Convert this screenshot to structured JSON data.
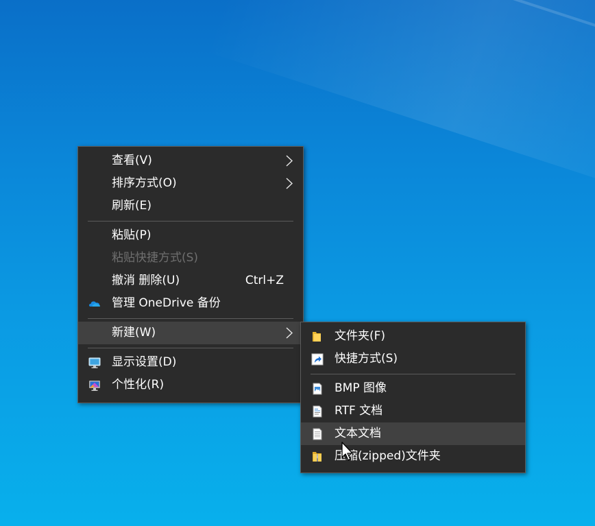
{
  "context_menu": {
    "items": [
      {
        "label": "查看(V)",
        "has_submenu": true
      },
      {
        "label": "排序方式(O)",
        "has_submenu": true
      },
      {
        "label": "刷新(E)"
      },
      {
        "label": "粘贴(P)"
      },
      {
        "label": "粘贴快捷方式(S)",
        "disabled": true
      },
      {
        "label": "撤消 删除(U)",
        "shortcut": "Ctrl+Z"
      },
      {
        "label": "管理 OneDrive 备份",
        "icon": "onedrive-icon"
      },
      {
        "label": "新建(W)",
        "has_submenu": true,
        "highlighted": true
      },
      {
        "label": "显示设置(D)",
        "icon": "display-settings-icon"
      },
      {
        "label": "个性化(R)",
        "icon": "personalize-icon"
      }
    ]
  },
  "new_submenu": {
    "items": [
      {
        "label": "文件夹(F)",
        "icon": "folder-icon"
      },
      {
        "label": "快捷方式(S)",
        "icon": "shortcut-icon"
      },
      {
        "label": "BMP 图像",
        "icon": "bitmap-icon"
      },
      {
        "label": "RTF 文档",
        "icon": "rtf-document-icon"
      },
      {
        "label": "文本文档",
        "icon": "text-document-icon",
        "highlighted": true
      },
      {
        "label": "压缩(zipped)文件夹",
        "icon": "zip-folder-icon"
      }
    ]
  },
  "colors": {
    "menu_background": "#2b2b2b",
    "menu_hover": "#414141",
    "menu_text": "#ffffff",
    "menu_disabled_text": "#6f6f6f",
    "desktop_background": "#0b86d8"
  }
}
